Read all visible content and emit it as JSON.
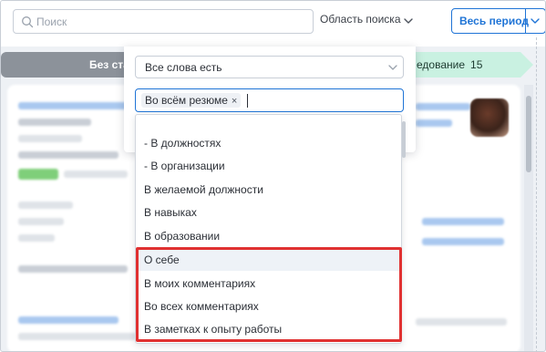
{
  "search": {
    "placeholder": "Поиск"
  },
  "search_area": {
    "label": "Область поиска"
  },
  "period": {
    "label": "Весь период"
  },
  "stages": {
    "left_label": "Без ста",
    "right_label": "едование",
    "right_count": "15"
  },
  "dropdown": {
    "mode_select": "Все слова есть",
    "selected_tag": "Во всём резюме",
    "tag_remove": "×",
    "options": [
      "- В должностях",
      "- В организации",
      "В желаемой должности",
      "В навыках",
      "В образовании",
      "О себе",
      "В моих комментариях",
      "Во всех комментариях",
      "В заметках к опыту работы"
    ]
  },
  "colors": {
    "accent": "#1f74d6",
    "highlight_box": "#e03131",
    "stage_done": "#8c929a",
    "stage_active": "#c9f1e1"
  },
  "icons": {
    "search": "magnifier",
    "chevron": "chevron-down"
  }
}
